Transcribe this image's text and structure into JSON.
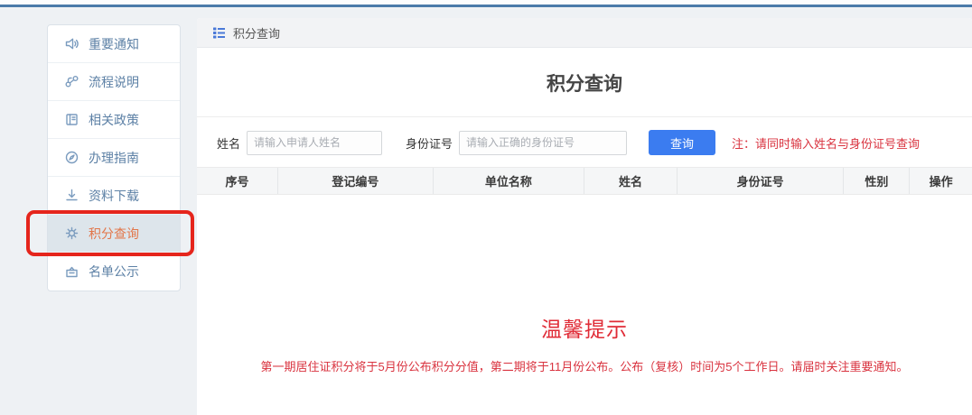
{
  "sidebar": {
    "items": [
      {
        "label": "重要通知",
        "icon": "speaker-icon",
        "active": false
      },
      {
        "label": "流程说明",
        "icon": "flow-icon",
        "active": false
      },
      {
        "label": "相关政策",
        "icon": "policy-icon",
        "active": false
      },
      {
        "label": "办理指南",
        "icon": "compass-icon",
        "active": false
      },
      {
        "label": "资料下载",
        "icon": "download-icon",
        "active": false
      },
      {
        "label": "积分查询",
        "icon": "points-icon",
        "active": true,
        "annotated": true
      },
      {
        "label": "名单公示",
        "icon": "board-icon",
        "active": false
      }
    ]
  },
  "main": {
    "breadcrumb": "积分查询",
    "title": "积分查询",
    "form": {
      "name_label": "姓名",
      "name_placeholder": "请输入申请人姓名",
      "id_label": "身份证号",
      "id_placeholder": "请输入正确的身份证号",
      "query_button": "查询",
      "note": "注：请同时输入姓名与身份证号查询"
    },
    "table": {
      "headers": [
        "序号",
        "登记编号",
        "单位名称",
        "姓名",
        "身份证号",
        "性别",
        "操作"
      ],
      "rows": []
    },
    "notice": {
      "title": "温馨提示",
      "body": "第一期居住证积分将于5月份公布积分分值，第二期将于11月份公布。公布（复核）时间为5个工作日。请届时关注重要通知。"
    }
  },
  "colors": {
    "top_line": "#4a7aa9",
    "accent_blue": "#3b7cf0",
    "active_orange": "#e2764a",
    "annotation_red": "#e5251c",
    "note_red": "#d9333f"
  }
}
